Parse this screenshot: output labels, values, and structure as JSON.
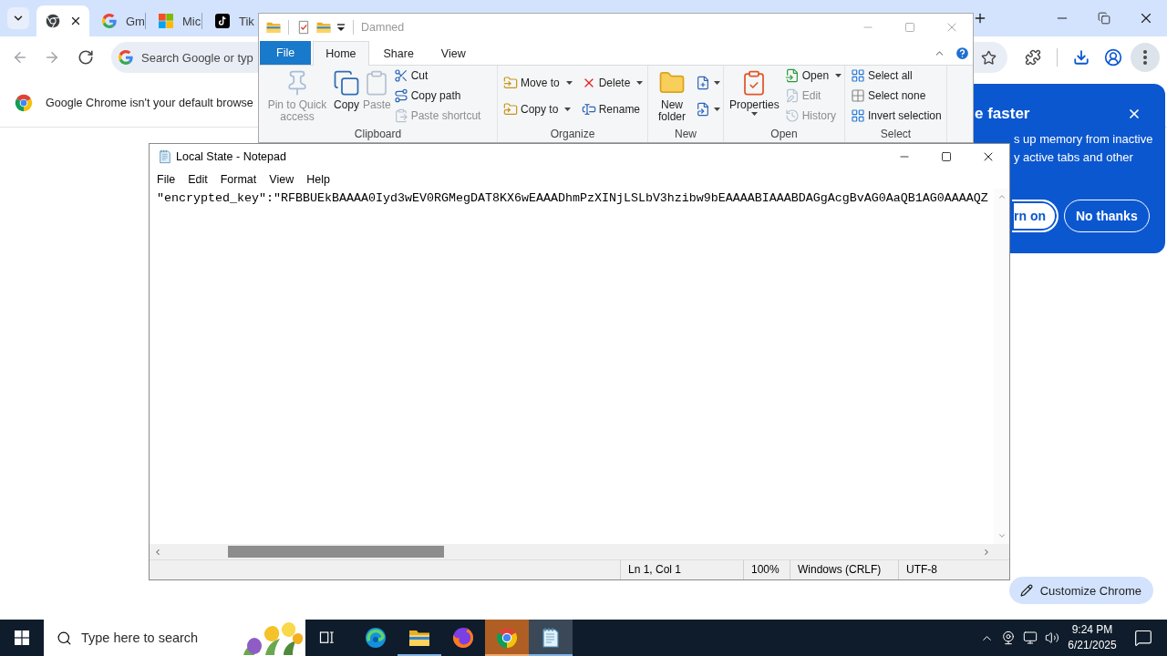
{
  "browser": {
    "tabs": [
      {
        "selected": true
      },
      {
        "title": "Gm",
        "selected": false
      },
      {
        "title": "Mic",
        "selected": false
      },
      {
        "title": "Tik",
        "selected": false
      }
    ],
    "omnibox": {
      "placeholder": "Search Google or typ"
    },
    "infobar": {
      "text": "Google Chrome isn't your default browse"
    },
    "customize_button": "Customize Chrome"
  },
  "memory_saver_popup": {
    "title": "e faster",
    "lines": [
      "s up memory from inactive",
      "y active tabs and other"
    ],
    "buttons": [
      {
        "label": "rn on",
        "kind": "primary"
      },
      {
        "label": "No thanks",
        "kind": "secondary"
      }
    ]
  },
  "explorer": {
    "title": "Damned",
    "ribbon_tabs": [
      {
        "label": "File",
        "kind": "file",
        "selected": false
      },
      {
        "label": "Home",
        "kind": "tab",
        "selected": true
      },
      {
        "label": "Share",
        "kind": "tab",
        "selected": false
      },
      {
        "label": "View",
        "kind": "tab",
        "selected": false
      }
    ],
    "groups": [
      {
        "label": "Clipboard",
        "columns": [
          {
            "kind": "large",
            "items": [
              {
                "label": "Pin to Quick access",
                "disabled": true,
                "dropdown": false
              }
            ]
          },
          {
            "kind": "large",
            "items": [
              {
                "label": "Copy",
                "disabled": false,
                "dropdown": false
              }
            ]
          },
          {
            "kind": "large",
            "items": [
              {
                "label": "Paste",
                "disabled": true,
                "dropdown": false
              }
            ]
          },
          {
            "kind": "small",
            "items": [
              {
                "label": "Cut",
                "disabled": false,
                "dropdown": false
              },
              {
                "label": "Copy path",
                "disabled": false,
                "dropdown": false
              },
              {
                "label": "Paste shortcut",
                "disabled": true,
                "dropdown": false
              }
            ]
          }
        ]
      },
      {
        "label": "Organize",
        "columns": [
          {
            "kind": "small",
            "items": [
              {
                "label": "Move to",
                "disabled": false,
                "dropdown": true
              },
              {
                "label": "Copy to",
                "disabled": false,
                "dropdown": true
              }
            ]
          },
          {
            "kind": "small",
            "items": [
              {
                "label": "Delete",
                "disabled": false,
                "dropdown": true
              },
              {
                "label": "Rename",
                "disabled": false,
                "dropdown": false
              }
            ]
          }
        ]
      },
      {
        "label": "New",
        "columns": [
          {
            "kind": "large",
            "items": [
              {
                "label": "New folder",
                "disabled": false,
                "dropdown": false
              }
            ]
          },
          {
            "kind": "small",
            "items": [
              {
                "disabled": false,
                "dropdown": true
              },
              {
                "disabled": false,
                "dropdown": true
              }
            ]
          }
        ]
      },
      {
        "label": "Open",
        "columns": [
          {
            "kind": "large",
            "items": [
              {
                "label": "Properties",
                "disabled": false,
                "dropdown": true
              }
            ]
          },
          {
            "kind": "small",
            "items": [
              {
                "label": "Open",
                "disabled": false,
                "dropdown": true
              },
              {
                "label": "Edit",
                "disabled": true,
                "dropdown": false
              },
              {
                "label": "History",
                "disabled": true,
                "dropdown": false
              }
            ]
          }
        ]
      },
      {
        "label": "Select",
        "columns": [
          {
            "kind": "small",
            "items": [
              {
                "label": "Select all",
                "disabled": false,
                "dropdown": false
              },
              {
                "label": "Select none",
                "disabled": false,
                "dropdown": false
              },
              {
                "label": "Invert selection",
                "disabled": false,
                "dropdown": false
              }
            ]
          }
        ]
      }
    ]
  },
  "notepad": {
    "title": "Local State - Notepad",
    "menu": [
      "File",
      "Edit",
      "Format",
      "View",
      "Help"
    ],
    "text": "\"encrypted_key\":\"RFBBUEkBAAAA0Iyd3wEV0RGMegDAT8KX6wEAAADhmPzXINjLSLbV3hzibw9bEAAAABIAAABDAGgAcgBvAG0AaQB1AG0AAAAQZ",
    "status": [
      "Ln 1, Col 1",
      "100%",
      "Windows (CRLF)",
      "UTF-8"
    ]
  },
  "taskbar": {
    "search_placeholder": "Type here to search",
    "apps": [
      {
        "running": false,
        "selected": false,
        "flashing": false
      },
      {
        "running": true,
        "selected": false,
        "flashing": false
      },
      {
        "running": false,
        "selected": false,
        "flashing": false
      },
      {
        "running": true,
        "selected": false,
        "flashing": true
      },
      {
        "running": true,
        "selected": true,
        "flashing": false
      }
    ],
    "time": "9:24 PM",
    "date": "6/21/2025"
  }
}
